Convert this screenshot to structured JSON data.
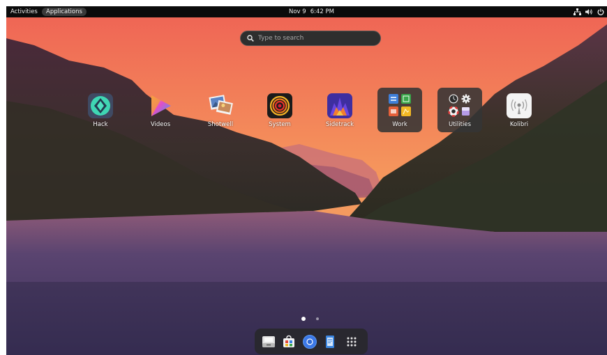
{
  "topbar": {
    "activities": "Activities",
    "applications": "Applications",
    "date": "Nov 9",
    "time": "6:42 PM",
    "tray_icons": [
      "network-icon",
      "volume-icon",
      "power-icon"
    ]
  },
  "search": {
    "placeholder": "Type to search"
  },
  "apps": [
    {
      "label": "Hack",
      "icon": "hack-icon"
    },
    {
      "label": "Videos",
      "icon": "videos-icon"
    },
    {
      "label": "Shotwell",
      "icon": "shotwell-icon"
    },
    {
      "label": "System",
      "icon": "system-icon"
    },
    {
      "label": "Sidetrack",
      "icon": "sidetrack-icon"
    },
    {
      "label": "Work",
      "icon": "work-folder-icon"
    },
    {
      "label": "Utilities",
      "icon": "utilities-folder-icon"
    },
    {
      "label": "Kolibri",
      "icon": "kolibri-icon"
    }
  ],
  "pager": {
    "pages": 2,
    "current": 1
  },
  "dock": [
    "files-icon",
    "app-center-icon",
    "chromium-icon",
    "text-editor-icon",
    "show-apps-icon"
  ],
  "colors": {
    "topbar": "#0b0b0b",
    "sky_top": "#f06a5a",
    "sky_bottom": "#f5a35a",
    "water": "#4a3a63"
  }
}
